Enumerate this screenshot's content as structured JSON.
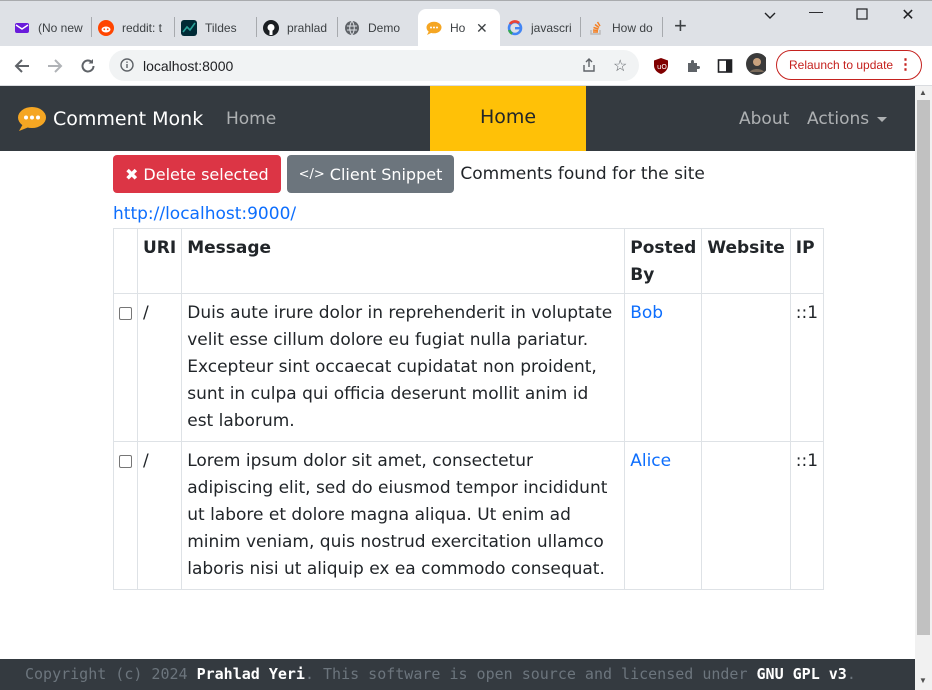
{
  "browser": {
    "tabs": [
      {
        "label": "(No new"
      },
      {
        "label": "reddit: t"
      },
      {
        "label": "Tildes"
      },
      {
        "label": "prahlad"
      },
      {
        "label": "Demo"
      },
      {
        "label": "Ho"
      },
      {
        "label": "javascri"
      },
      {
        "label": "How do"
      }
    ],
    "url": "localhost:8000",
    "relaunch_label": "Relaunch to update"
  },
  "navbar": {
    "brand": "Comment Monk",
    "home_link": "Home",
    "center_label": "Home",
    "about": "About",
    "actions": "Actions"
  },
  "toolbar": {
    "delete_label": "Delete selected",
    "snippet_label": "Client Snippet",
    "found_text": "Comments found for the site",
    "site_url": "http://localhost:9000/"
  },
  "table": {
    "headers": [
      "",
      "URI",
      "Message",
      "Posted By",
      "Website",
      "IP"
    ],
    "rows": [
      {
        "uri": "/",
        "message": "Duis aute irure dolor in reprehenderit in voluptate velit esse cillum dolore eu fugiat nulla pariatur. Excepteur sint occaecat cupidatat non proident, sunt in culpa qui officia deserunt mollit anim id est laborum.",
        "posted_by": "Bob",
        "website": "",
        "ip": "::1"
      },
      {
        "uri": "/",
        "message": "Lorem ipsum dolor sit amet, consectetur adipiscing elit, sed do eiusmod tempor incididunt ut labore et dolore magna aliqua. Ut enim ad minim veniam, quis nostrud exercitation ullamco laboris nisi ut aliquip ex ea commodo consequat.",
        "posted_by": "Alice",
        "website": "",
        "ip": "::1"
      }
    ]
  },
  "footer": {
    "prefix": "Copyright (c) 2024 ",
    "author": "Prahlad Yeri",
    "middle": ". This software is open source and licensed under ",
    "license": "GNU GPL v3",
    "suffix": "."
  }
}
